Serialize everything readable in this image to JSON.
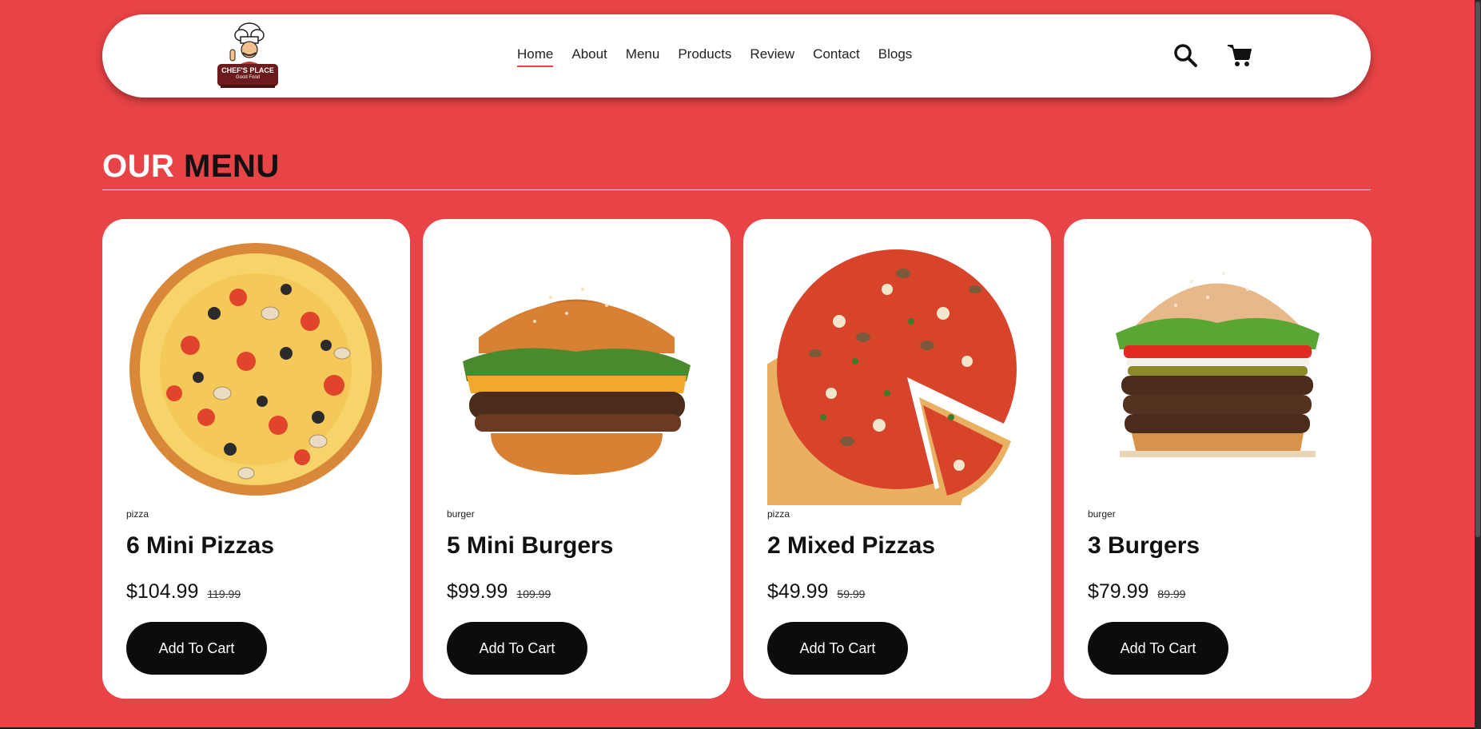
{
  "header": {
    "logo_line1": "CHEF'S PLACE",
    "logo_line2": "Good Food",
    "nav": [
      {
        "label": "Home"
      },
      {
        "label": "About"
      },
      {
        "label": "Menu"
      },
      {
        "label": "Products"
      },
      {
        "label": "Review"
      },
      {
        "label": "Contact"
      },
      {
        "label": "Blogs"
      }
    ],
    "active_nav": "Home",
    "icons": [
      "search-icon",
      "cart-icon"
    ]
  },
  "section": {
    "title_part1": "OUR",
    "title_part2": "MENU"
  },
  "products": [
    {
      "category": "pizza",
      "name": "6 Mini Pizzas",
      "price": "$104.99",
      "old_price": "119.99",
      "button": "Add To Cart",
      "image": "pizza"
    },
    {
      "category": "burger",
      "name": "5 Mini Burgers",
      "price": "$99.99",
      "old_price": "109.99",
      "button": "Add To Cart",
      "image": "burger"
    },
    {
      "category": "pizza",
      "name": "2 Mixed Pizzas",
      "price": "$49.99",
      "old_price": "59.99",
      "button": "Add To Cart",
      "image": "pizza-slice"
    },
    {
      "category": "burger",
      "name": "3 Burgers",
      "price": "$79.99",
      "old_price": "89.99",
      "button": "Add To Cart",
      "image": "triple-burger"
    }
  ],
  "colors": {
    "background": "#e84346",
    "button": "#0c0c0c",
    "card": "#ffffff"
  }
}
